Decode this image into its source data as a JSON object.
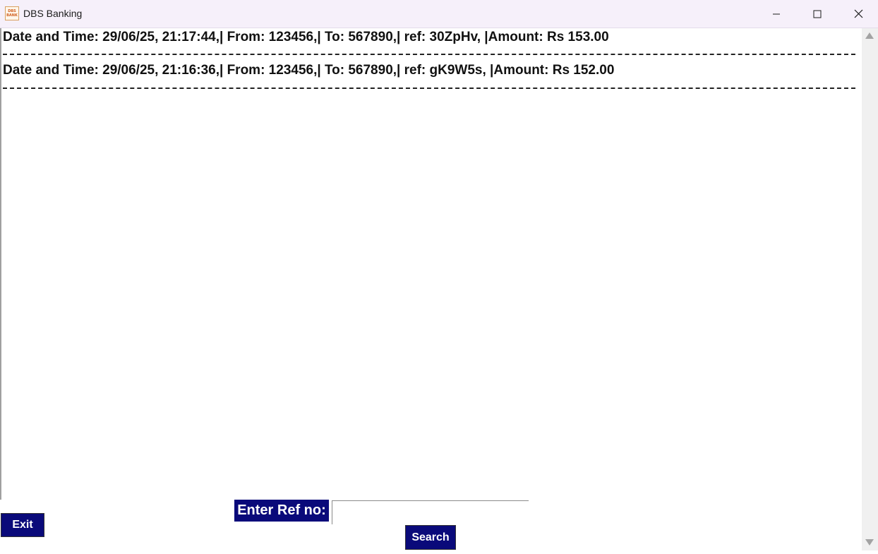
{
  "window": {
    "title": "DBS Banking",
    "icon_text": "DBS\nBANK",
    "icon": "dbs-bank-logo-icon"
  },
  "title_controls": {
    "minimize_icon": "minimize-icon",
    "maximize_icon": "maximize-icon",
    "close_icon": "close-icon"
  },
  "transactions": [
    {
      "text": "Date and Time: 29/06/25, 21:17:44,| From: 123456,| To: 567890,| ref: 30ZpHv, |Amount: Rs 153.00"
    },
    {
      "text": "Date and Time: 29/06/25, 21:16:36,| From: 123456,| To: 567890,| ref: gK9W5s, |Amount: Rs 152.00"
    }
  ],
  "controls": {
    "exit_label": "Exit",
    "ref_label": "Enter Ref no:",
    "ref_value": "",
    "search_label": "Search"
  },
  "colors": {
    "button_bg": "#0a0a7a",
    "button_text": "#ffffff",
    "titlebar_bg": "#f6f0fa"
  }
}
